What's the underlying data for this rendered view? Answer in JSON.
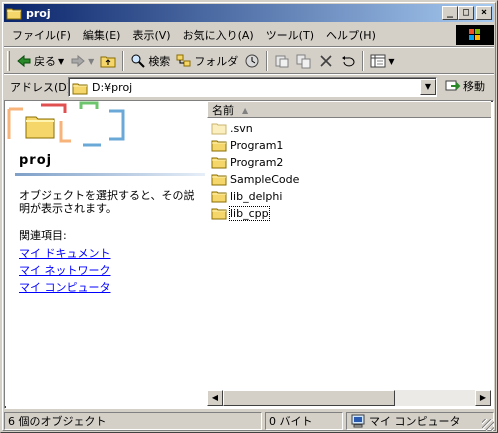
{
  "window": {
    "title": "proj"
  },
  "menu": [
    "ファイル(F)",
    "編集(E)",
    "表示(V)",
    "お気に入り(A)",
    "ツール(T)",
    "ヘルプ(H)"
  ],
  "toolbar": {
    "back_label": "戻る",
    "search_label": "検索",
    "folders_label": "フォルダ"
  },
  "address": {
    "label": "アドレス(D)",
    "value": "D:¥proj",
    "go_label": "移動"
  },
  "left_pane": {
    "title": "proj",
    "description": "オブジェクトを選択すると、その説明が表示されます。",
    "related_heading": "関連項目:",
    "links": [
      "マイ ドキュメント",
      "マイ ネットワーク",
      "マイ コンピュータ"
    ]
  },
  "list": {
    "column_name": "名前",
    "items": [
      ".svn",
      "Program1",
      "Program2",
      "SampleCode",
      "lib_delphi",
      "lib_cpp"
    ]
  },
  "status": {
    "objects": "6 個のオブジェクト",
    "size": "0 バイト",
    "location": "マイ コンピュータ"
  },
  "colors": {
    "title_start": "#0a246a",
    "title_end": "#a6caf0",
    "link": "#0000ff",
    "folder": "#f5d66a"
  }
}
